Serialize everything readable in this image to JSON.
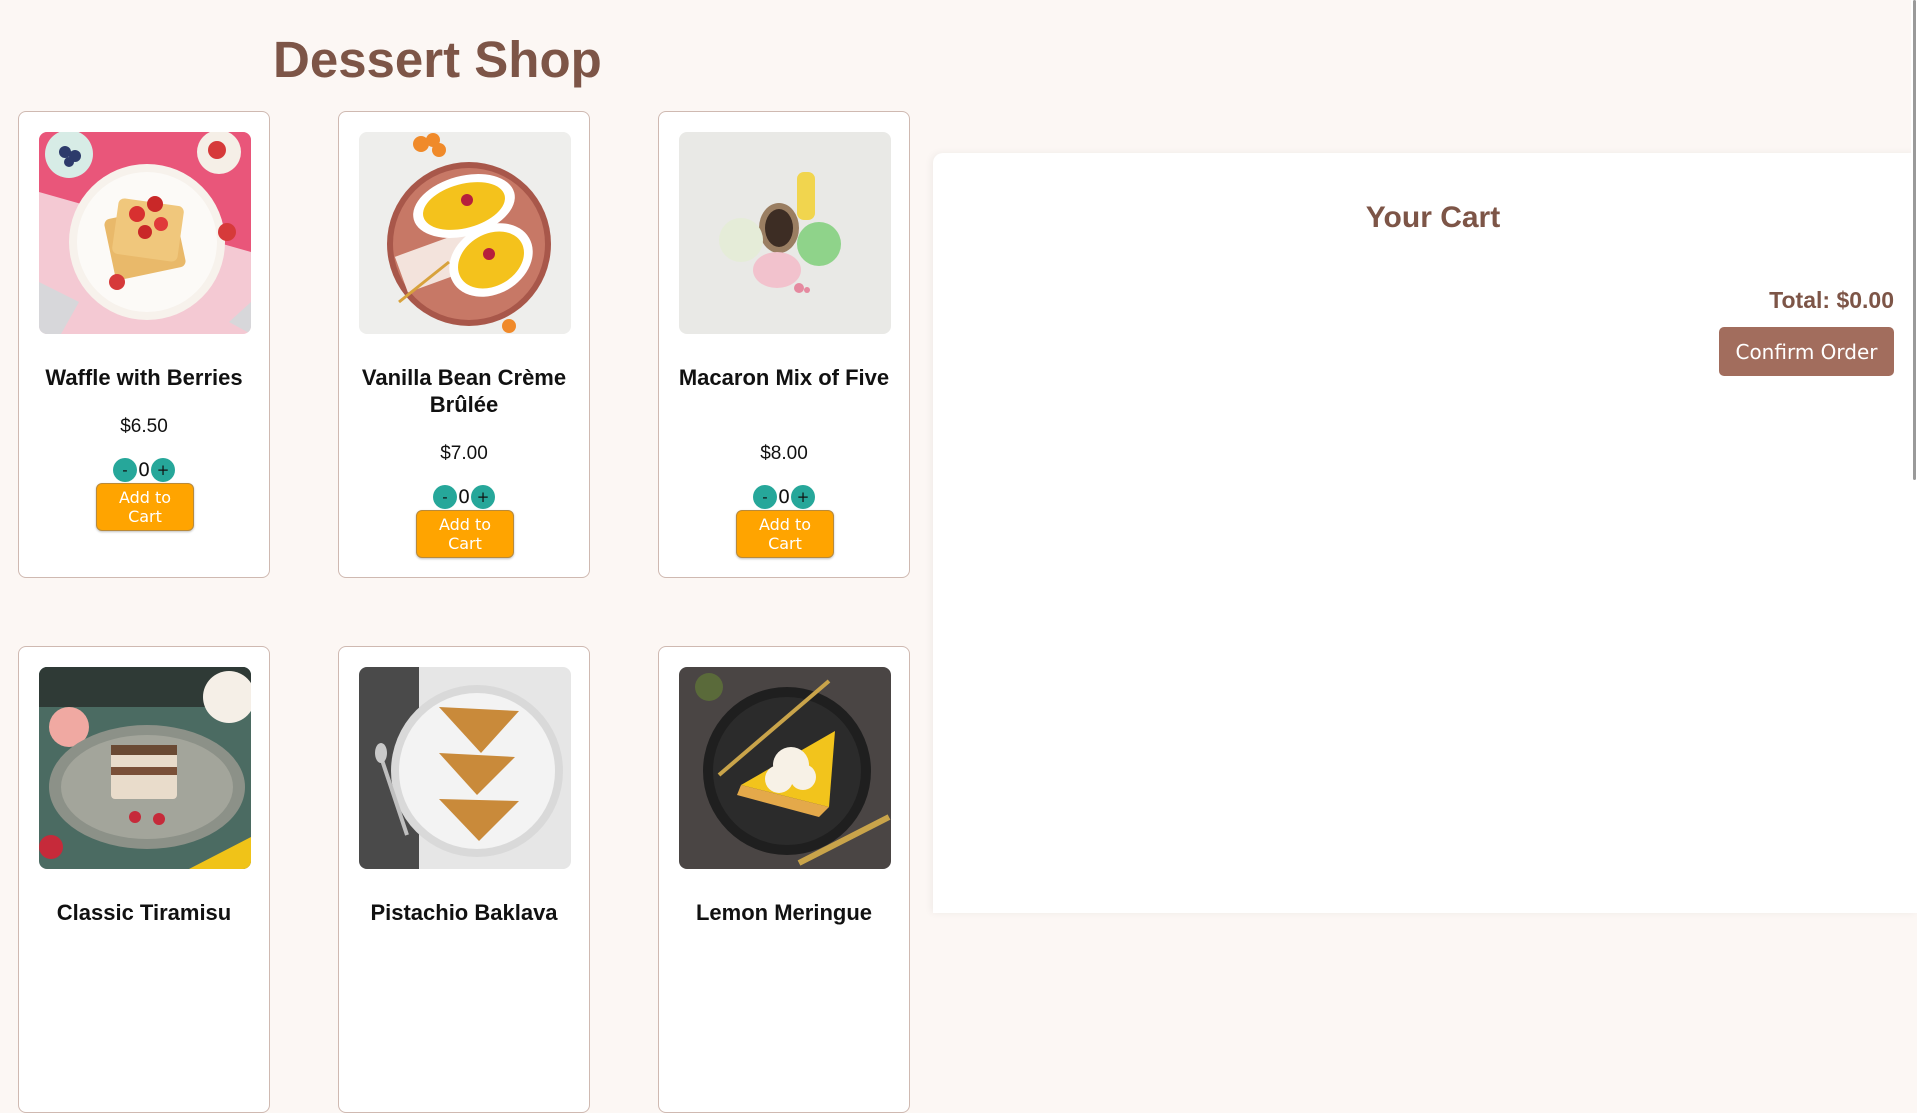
{
  "shop": {
    "title": "Dessert Shop"
  },
  "products": [
    {
      "name": "Waffle with Berries",
      "price": "$6.50",
      "quantity": "0",
      "add_label": "Add to Cart",
      "decrease_label": "-",
      "increase_label": "+"
    },
    {
      "name": "Vanilla Bean Crème Brûlée",
      "price": "$7.00",
      "quantity": "0",
      "add_label": "Add to Cart",
      "decrease_label": "-",
      "increase_label": "+"
    },
    {
      "name": "Macaron Mix of Five",
      "price": "$8.00",
      "quantity": "0",
      "add_label": "Add to Cart",
      "decrease_label": "-",
      "increase_label": "+"
    },
    {
      "name": "Classic Tiramisu"
    },
    {
      "name": "Pistachio Baklava"
    },
    {
      "name": "Lemon Meringue"
    }
  ],
  "cart": {
    "title": "Your Cart",
    "total": "Total: $0.00",
    "confirm_label": "Confirm Order"
  },
  "colors": {
    "brand": "#7d5547",
    "add_button": "#ffa400",
    "qty_button": "#26a79a",
    "confirm_button": "#a26d5d"
  }
}
